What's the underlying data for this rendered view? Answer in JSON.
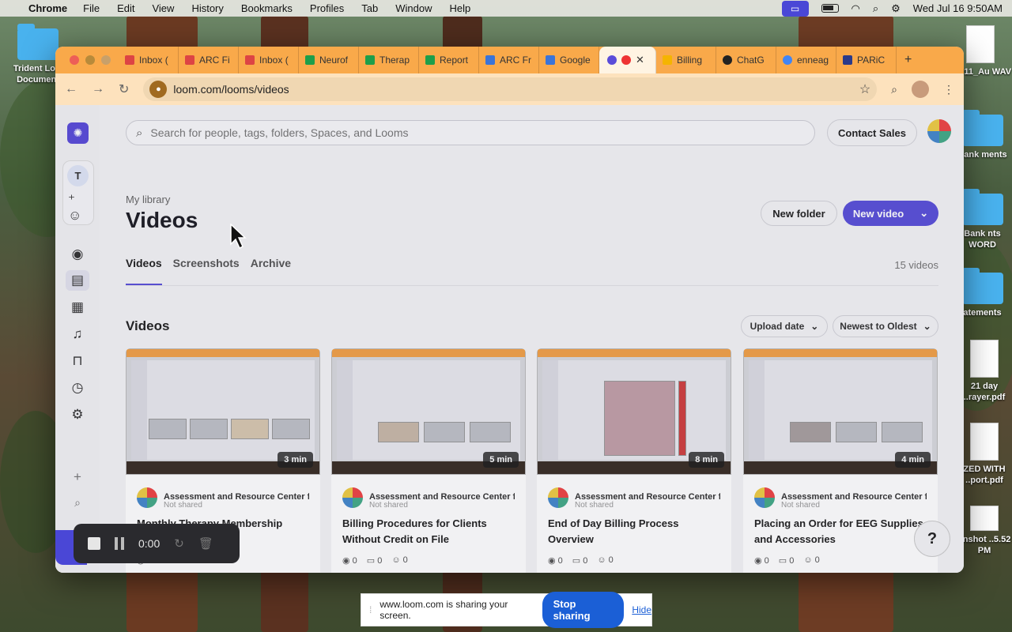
{
  "menubar": {
    "app": "Chrome",
    "items": [
      "File",
      "Edit",
      "View",
      "History",
      "Bookmarks",
      "Profiles",
      "Tab",
      "Window",
      "Help"
    ],
    "datetime": "Wed Jul 16  9:50AM"
  },
  "desktop": {
    "icons": [
      {
        "label": "Trident Lo... Document"
      },
      {
        "label": "6_911_Au WAV"
      },
      {
        "label": "Bank ments"
      },
      {
        "label": "Bank nts WORD"
      },
      {
        "label": "atements"
      },
      {
        "label": "21 day ..rayer.pdf"
      },
      {
        "label": "ZED WITH ..port.pdf"
      },
      {
        "label": "enshot ..5.52 PM"
      }
    ]
  },
  "browser": {
    "tabs": [
      {
        "label": "Inbox (",
        "color": "#d44"
      },
      {
        "label": "ARC Fi",
        "color": "#d44"
      },
      {
        "label": "Inbox (",
        "color": "#d44"
      },
      {
        "label": "Neurof",
        "color": "#1e9e4a"
      },
      {
        "label": "Therap",
        "color": "#1e9e4a"
      },
      {
        "label": "Report",
        "color": "#1e9e4a"
      },
      {
        "label": "ARC Fr",
        "color": "#3b74d8"
      },
      {
        "label": "Google",
        "color": "#3b74d8"
      },
      {
        "label": "",
        "color": "#5a4cd9",
        "active": true
      },
      {
        "label": "Billing",
        "color": "#f5b400"
      },
      {
        "label": "ChatG",
        "color": "#222"
      },
      {
        "label": "enneag",
        "color": "#4285f4"
      },
      {
        "label": "PARiC",
        "color": "#2a3a8a"
      }
    ],
    "new_tab": "+",
    "url": "loom.com/looms/videos"
  },
  "app": {
    "search_placeholder": "Search for people, tags, folders, Spaces, and Looms",
    "contact_sales": "Contact Sales",
    "sidebar_initial": "T",
    "breadcrumb": "My library",
    "title": "Videos",
    "new_folder": "New folder",
    "new_video": "New video",
    "tabs": [
      "Videos",
      "Screenshots",
      "Archive"
    ],
    "video_count": "15 videos",
    "section_title": "Videos",
    "filter_date": "Upload date",
    "filter_order": "Newest to Oldest",
    "help": "?",
    "cards": [
      {
        "duration": "3 min",
        "owner": "Assessment and Resource Center f",
        "shared": "Not shared",
        "title": "Monthly Therapy Membership",
        "views": "0",
        "comments": "0",
        "reactions": "0"
      },
      {
        "duration": "5 min",
        "owner": "Assessment and Resource Center f",
        "shared": "Not shared",
        "title": "Billing Procedures for Clients Without Credit on File",
        "views": "0",
        "comments": "0",
        "reactions": "0"
      },
      {
        "duration": "8 min",
        "owner": "Assessment and Resource Center f",
        "shared": "Not shared",
        "title": "End of Day Billing Process Overview",
        "views": "0",
        "comments": "0",
        "reactions": "0"
      },
      {
        "duration": "4 min",
        "owner": "Assessment and Resource Center f",
        "shared": "Not shared",
        "title": "Placing an Order for EEG Supplies and Accessories",
        "views": "0",
        "comments": "0",
        "reactions": "0"
      }
    ]
  },
  "recorder": {
    "time": "0:00"
  },
  "share_banner": {
    "text": "www.loom.com is sharing your screen.",
    "stop": "Stop sharing",
    "hide": "Hide"
  }
}
